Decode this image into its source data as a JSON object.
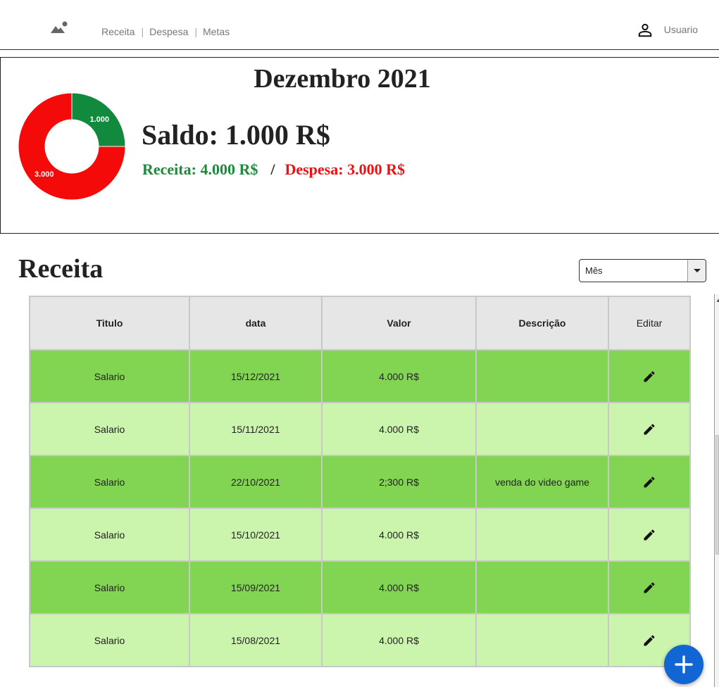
{
  "header": {
    "logo_icon": "image-icon",
    "nav": [
      {
        "label": "Receita"
      },
      {
        "label": "Despesa"
      },
      {
        "label": "Metas"
      }
    ],
    "user_icon": "person-icon",
    "user_label": "Usuario"
  },
  "summary": {
    "title": "Dezembro 2021",
    "saldo": "Saldo: 1.000 R$",
    "receita": "Receita: 4.000 R$",
    "separator": "/",
    "despesa": "Despesa: 3.000 R$"
  },
  "chart_data": {
    "type": "pie",
    "variant": "donut",
    "slices": [
      {
        "label": "1.000",
        "value": 1000,
        "color": "#118a3e"
      },
      {
        "label": "3.000",
        "value": 3000,
        "color": "#f50a0a"
      }
    ]
  },
  "section": {
    "title": "Receita",
    "filter_selected": "Mês"
  },
  "table": {
    "columns": [
      "Titulo",
      "data",
      "Valor",
      "Descrição",
      "Editar"
    ],
    "rows": [
      {
        "titulo": "Salario",
        "data": "15/12/2021",
        "valor": "4.000 R$",
        "descricao": ""
      },
      {
        "titulo": "Salario",
        "data": "15/11/2021",
        "valor": "4.000 R$",
        "descricao": ""
      },
      {
        "titulo": "Salario",
        "data": "22/10/2021",
        "valor": "2;300 R$",
        "descricao": "venda do video game"
      },
      {
        "titulo": "Salario",
        "data": "15/10/2021",
        "valor": "4.000 R$",
        "descricao": ""
      },
      {
        "titulo": "Salario",
        "data": "15/09/2021",
        "valor": "4.000 R$",
        "descricao": ""
      },
      {
        "titulo": "Salario",
        "data": "15/08/2021",
        "valor": "4.000 R$",
        "descricao": ""
      }
    ],
    "edit_icon": "pencil-icon"
  },
  "fab_icon": "plus-icon",
  "colors": {
    "receita": "#1e8a3c",
    "despesa": "#ee1111",
    "row_dark": "#82d453",
    "row_light": "#cbf5ad",
    "fab": "#1266d4"
  }
}
